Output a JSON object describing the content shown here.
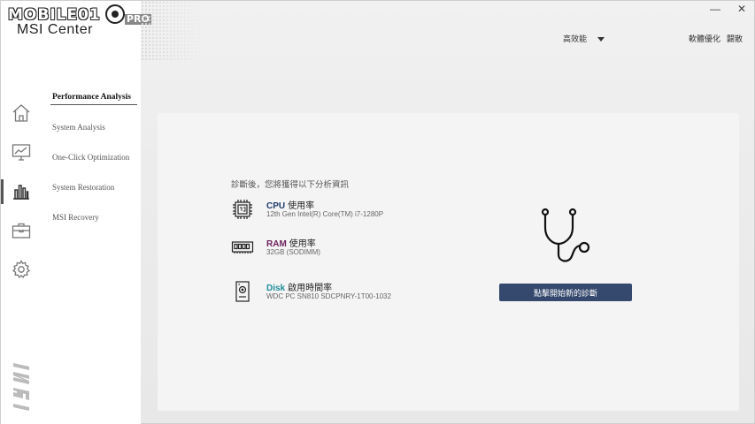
{
  "app": {
    "watermark": "MOBILE01",
    "watermark_suffix": "PRO",
    "title": "MSI Center"
  },
  "window_controls": {
    "minimize": "—",
    "close": "✕"
  },
  "topbar": {
    "mode_label": "高效能",
    "links": [
      "軟體優化",
      "闢散"
    ]
  },
  "rail": {
    "icons": [
      "home-icon",
      "monitor-chart-icon",
      "bar-chart-icon",
      "toolbox-icon",
      "gear-icon"
    ],
    "active_index": 2
  },
  "menu": {
    "items": [
      {
        "label": "Performance Analysis",
        "active": true
      },
      {
        "label": "System Analysis",
        "active": false
      },
      {
        "label": "One-Click Optimization",
        "active": false
      },
      {
        "label": "System Restoration",
        "active": false
      },
      {
        "label": "MSI Recovery",
        "active": false
      }
    ]
  },
  "panel": {
    "intro": "診斷後，您將獲得以下分析資訊",
    "rows": [
      {
        "name": "CPU",
        "label": "使用率",
        "sub": "12th Gen Intel(R) Core(TM) i7-1280P",
        "icon": "cpu-chip-icon"
      },
      {
        "name": "RAM",
        "label": "使用率",
        "sub": "32GB (SODIMM)",
        "icon": "ram-module-icon"
      },
      {
        "name": "Disk",
        "label": "啟用時間率",
        "sub": "WDC PC SN810 SDCPNRY-1T00-1032",
        "icon": "disk-drive-icon"
      }
    ],
    "button": "點擊開始新的診斷"
  },
  "colors": {
    "cpu": "#1f3b6b",
    "ram": "#6b1f5a",
    "disk": "#1d8e9a",
    "button": "#35496e"
  }
}
